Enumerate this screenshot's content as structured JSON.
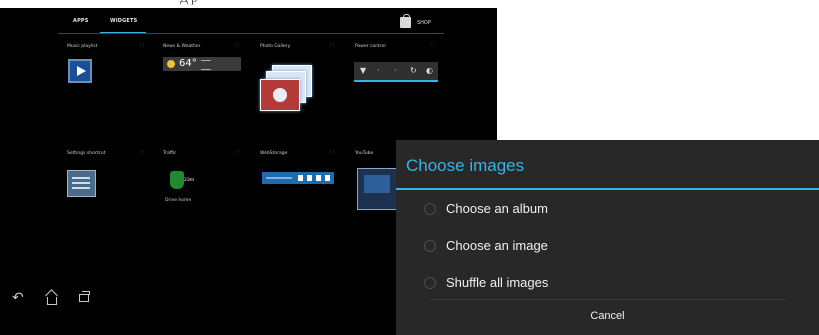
{
  "top_caption": "Д р",
  "tabs": {
    "apps": "APPS",
    "widgets": "WIDGETS",
    "active": "WIDGETS"
  },
  "shop": {
    "label": "SHOP",
    "icon": "shop-bag-icon"
  },
  "widgets": [
    {
      "label": "Music playlist",
      "icon": "play-icon"
    },
    {
      "label": "News & Weather",
      "temperature": "64°",
      "icon": "sun-icon"
    },
    {
      "label": "Photo Gallery",
      "icon": "photo-stack-icon"
    },
    {
      "label": "Power control",
      "icon": "power-toggle-icon"
    },
    {
      "label": "Settings shortcut",
      "icon": "settings-icon"
    },
    {
      "label": "Traffic",
      "time": "23m",
      "caption": "Drive home",
      "icon": "traffic-icon"
    },
    {
      "label": "WebStorage",
      "icon": "cloud-storage-icon"
    },
    {
      "label": "YouTube",
      "icon": "youtube-icon"
    }
  ],
  "navbar": {
    "back_icon": "back-icon",
    "home_icon": "home-icon",
    "recent_icon": "recent-apps-icon"
  },
  "dialog": {
    "title": "Choose images",
    "options": [
      {
        "label": "Choose an album"
      },
      {
        "label": "Choose an image"
      },
      {
        "label": "Shuffle all images"
      }
    ],
    "cancel_label": "Cancel"
  },
  "colors": {
    "accent": "#33b5e5",
    "dialog_bg": "#282828",
    "screen_bg": "#000000"
  }
}
